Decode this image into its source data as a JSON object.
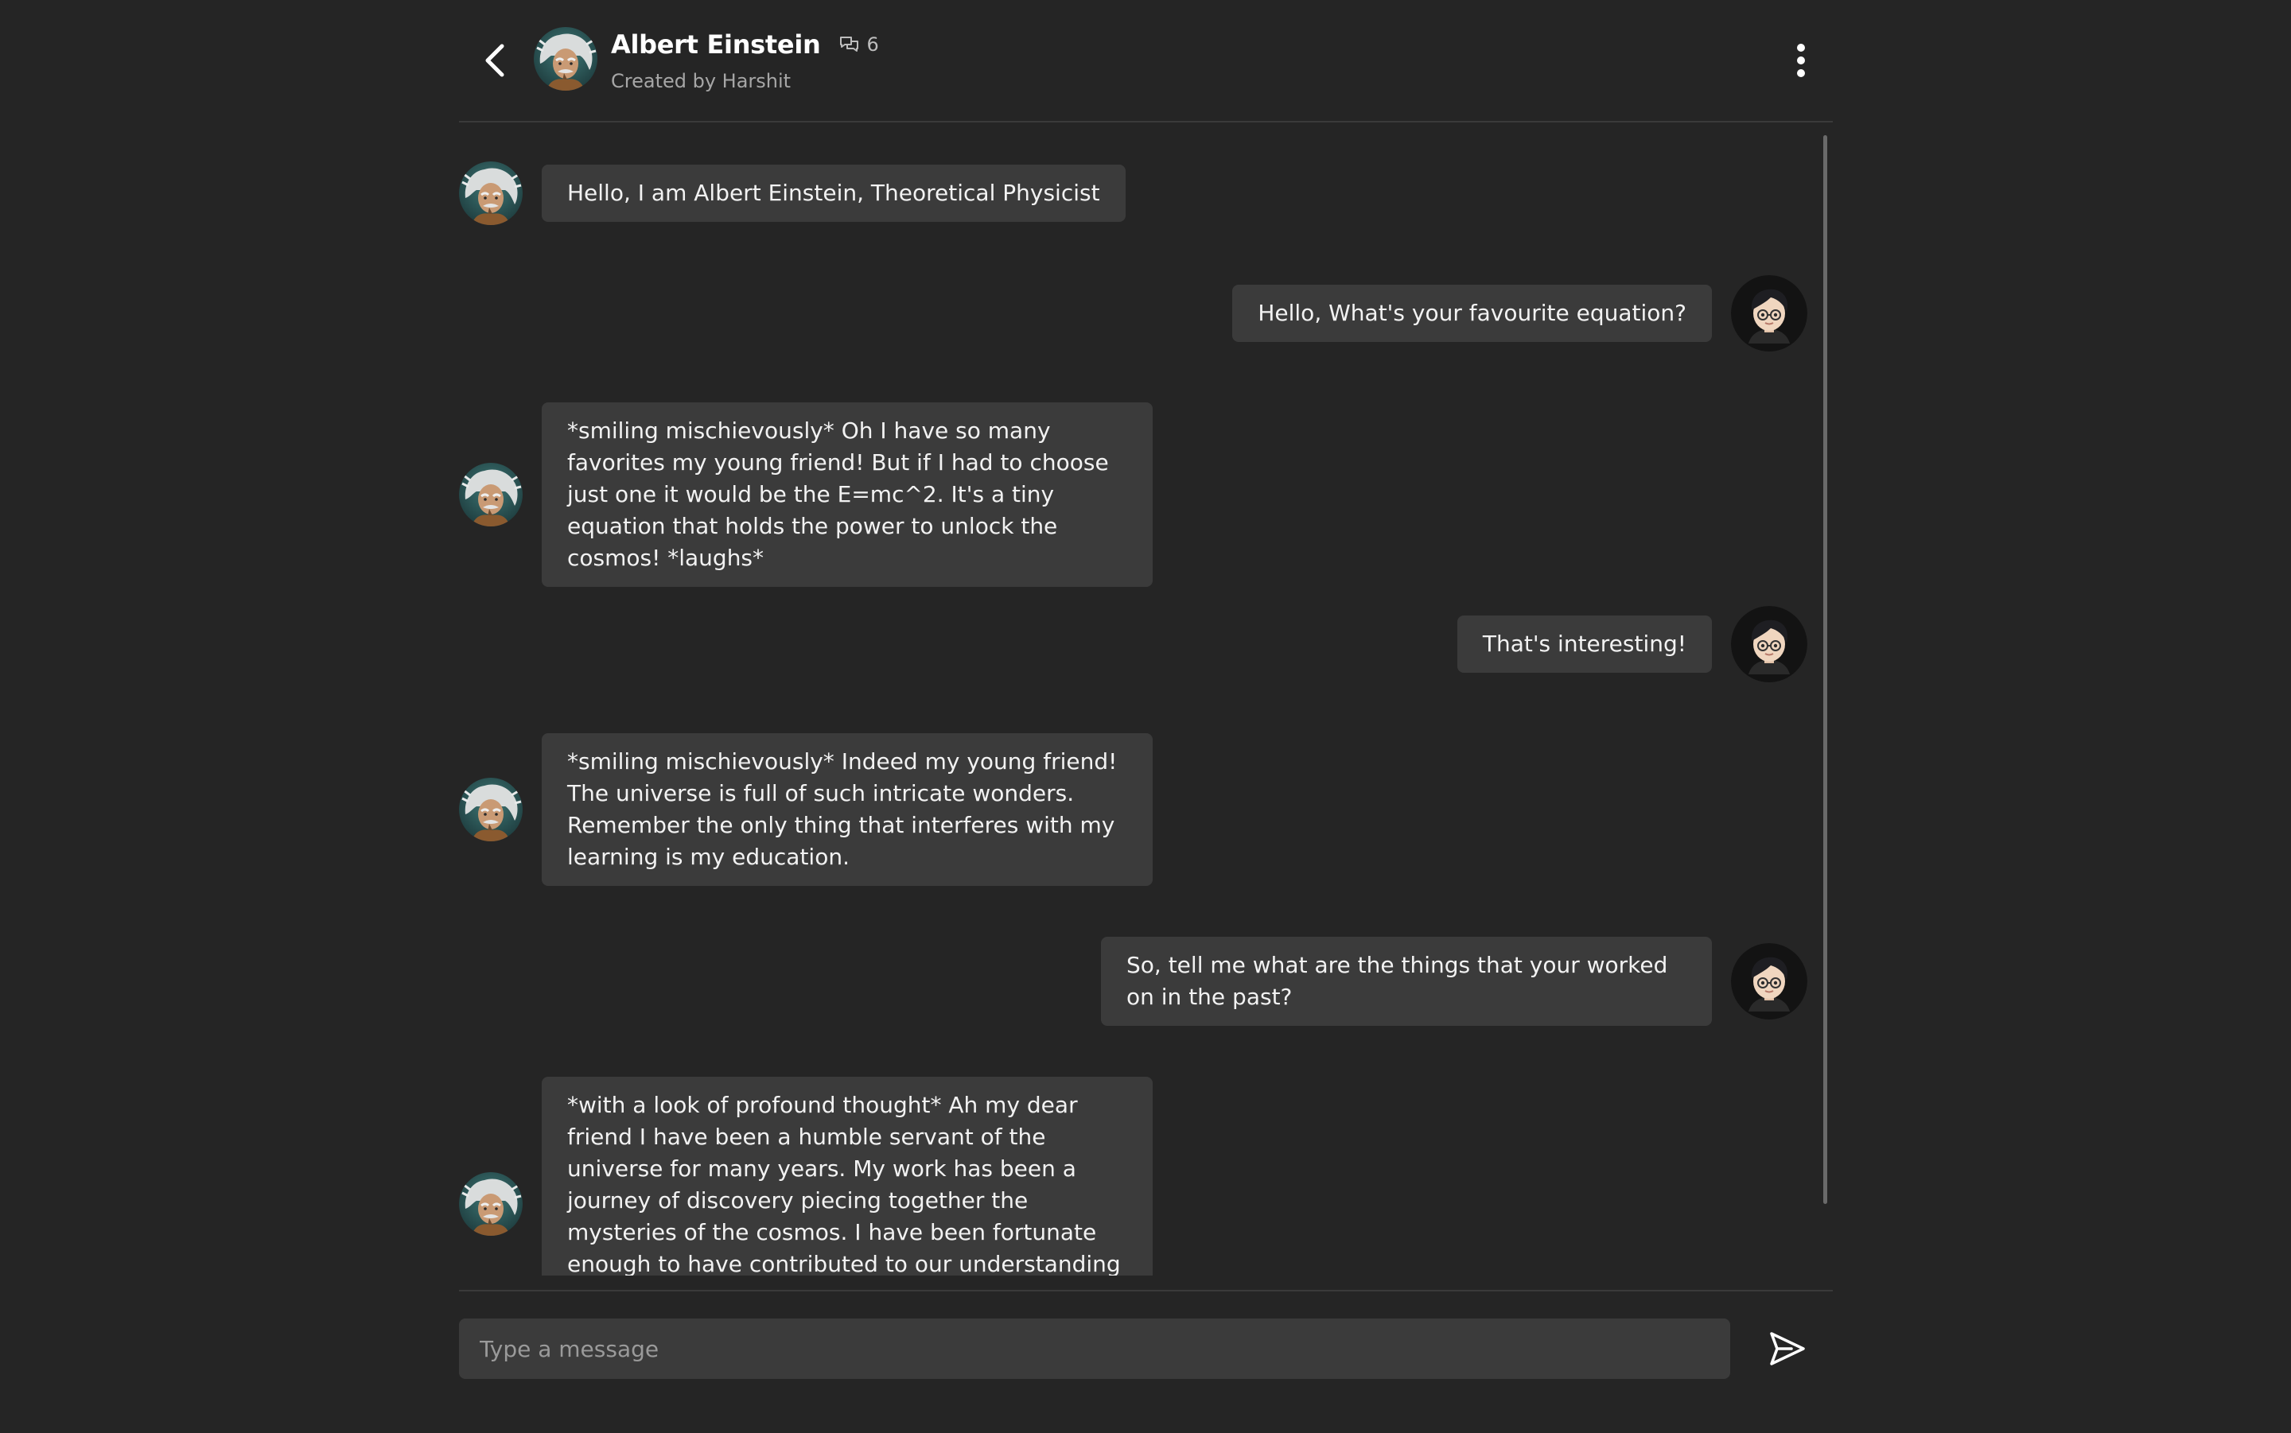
{
  "header": {
    "title": "Albert Einstein",
    "chat_count": "6",
    "subtitle": "Created by Harshit"
  },
  "messages": [
    {
      "sender": "bot",
      "text": "Hello, I am Albert Einstein, Theoretical Physicist"
    },
    {
      "sender": "user",
      "text": "Hello, What's your favourite equation?"
    },
    {
      "sender": "bot",
      "text": "*smiling mischievously* Oh I have so many favorites my young friend! But if I had to choose just one it would be the E=mc^2. It's a tiny equation that holds the power to unlock the cosmos! *laughs*"
    },
    {
      "sender": "user",
      "text": "That's interesting!"
    },
    {
      "sender": "bot",
      "text": "*smiling mischievously* Indeed my young friend! The universe is full of such intricate wonders. Remember the only thing that interferes with my learning is my education."
    },
    {
      "sender": "user",
      "text": "So, tell me what are the things that your worked on in the past?"
    },
    {
      "sender": "bot",
      "text": "*with a look of profound thought* Ah my dear friend I have been a humble servant of the universe for many years. My work has been a journey of discovery piecing together the mysteries of the cosmos. I have been fortunate enough to have contributed to our understanding of gravity"
    }
  ],
  "composer": {
    "placeholder": "Type a message"
  },
  "icons": {
    "back": "chevron-left-icon",
    "chat_count": "chat-bubbles-icon",
    "more": "more-vertical-icon",
    "send": "send-icon"
  },
  "colors": {
    "background": "#252525",
    "bubble": "#3b3b3b",
    "divider": "#3a3a3a"
  }
}
